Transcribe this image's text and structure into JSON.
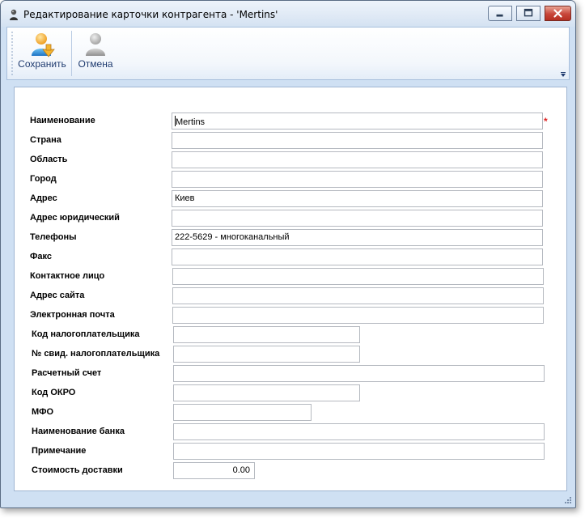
{
  "window": {
    "title": "Редактирование карточки контрагента - 'Mertins'"
  },
  "toolbar": {
    "save_label": "Сохранить",
    "cancel_label": "Отмена"
  },
  "form": {
    "fields": [
      {
        "label": "Наименование",
        "value": "Mertins",
        "required_mark": "*"
      },
      {
        "label": "Страна",
        "value": ""
      },
      {
        "label": "Область",
        "value": ""
      },
      {
        "label": "Город",
        "value": ""
      },
      {
        "label": "Адрес",
        "value": "Киев"
      },
      {
        "label": "Адрес юридический",
        "value": ""
      },
      {
        "label": "Телефоны",
        "value": "222-5629 - многоканальный"
      },
      {
        "label": "Факс",
        "value": ""
      },
      {
        "label": "Контактное лицо",
        "value": ""
      },
      {
        "label": "Адрес сайта",
        "value": ""
      },
      {
        "label": "Электронная почта",
        "value": ""
      },
      {
        "label": "Код налогоплательщика",
        "value": ""
      },
      {
        "label": "№ свид. налогоплательщика",
        "value": ""
      },
      {
        "label": "Расчетный счет",
        "value": ""
      },
      {
        "label": "Код ОКРО",
        "value": ""
      },
      {
        "label": "МФО",
        "value": ""
      },
      {
        "label": "Наименование банка",
        "value": ""
      },
      {
        "label": "Примечание",
        "value": ""
      },
      {
        "label": "Стоимость доставки",
        "value": "0.00"
      }
    ]
  }
}
